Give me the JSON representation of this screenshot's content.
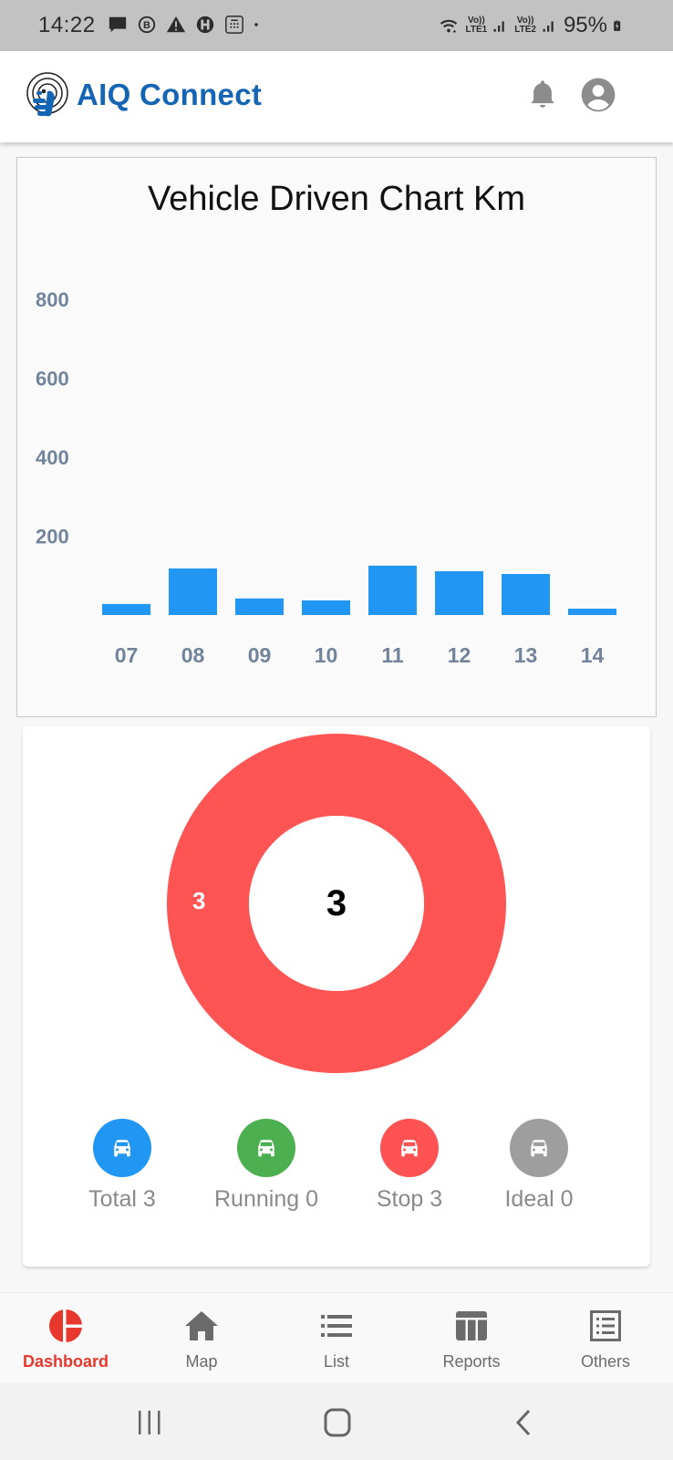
{
  "status_bar": {
    "time": "14:22",
    "notification_icons": [
      "message-icon",
      "b-circle-icon",
      "warning-icon",
      "hospital-icon",
      "calculator-icon",
      "dot-icon"
    ],
    "lte1_label": "LTE1",
    "lte2_label": "LTE2",
    "volte_label": "Vo))",
    "battery": "95%"
  },
  "app_bar": {
    "title": "AIQ Connect",
    "brand_color": "#1565b5"
  },
  "chart_data": {
    "type": "bar",
    "title": "Vehicle Driven Chart Km",
    "categories": [
      "07",
      "08",
      "09",
      "10",
      "11",
      "12",
      "13",
      "14"
    ],
    "values": [
      28,
      118,
      42,
      37,
      125,
      111,
      104,
      16
    ],
    "xlabel": "",
    "ylabel": "",
    "ylim": [
      0,
      800
    ],
    "yticks": [
      200,
      400,
      600,
      800
    ],
    "ytick_labels": [
      "200",
      "400",
      "600",
      "800"
    ],
    "grid": false,
    "legend": "none",
    "bar_color": "#2196f3",
    "tick_color": "#72849b"
  },
  "vehicle_status": {
    "donut": {
      "center_value": "3",
      "segments": [
        {
          "name": "Stop",
          "value": 3,
          "label": "3",
          "color": "#fe5454"
        }
      ]
    },
    "legend": [
      {
        "key": "total",
        "label": "Total 3",
        "color": "#2196f3",
        "icon": "car-icon"
      },
      {
        "key": "running",
        "label": "Running 0",
        "color": "#4caf50",
        "icon": "car-icon"
      },
      {
        "key": "stop",
        "label": "Stop 3",
        "color": "#ff5252",
        "icon": "car-icon"
      },
      {
        "key": "ideal",
        "label": "Ideal 0",
        "color": "#9e9e9e",
        "icon": "car-icon"
      }
    ]
  },
  "bottom_nav": {
    "items": [
      {
        "label": "Dashboard",
        "icon": "dashboard-pie-icon",
        "active": true
      },
      {
        "label": "Map",
        "icon": "home-icon",
        "active": false
      },
      {
        "label": "List",
        "icon": "list-icon",
        "active": false
      },
      {
        "label": "Reports",
        "icon": "table-icon",
        "active": false
      },
      {
        "label": "Others",
        "icon": "list-box-icon",
        "active": false
      }
    ],
    "active_color": "#e8372c"
  }
}
